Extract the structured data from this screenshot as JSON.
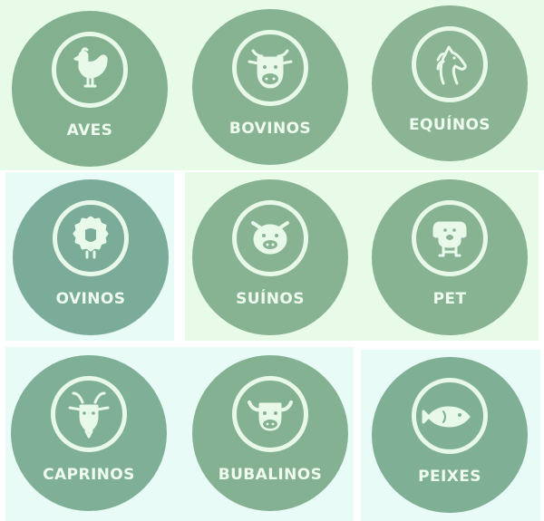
{
  "categories": [
    {
      "label": "AVES",
      "icon": "chicken-icon",
      "color": "#83b190"
    },
    {
      "label": "BOVINOS",
      "icon": "cow-icon",
      "color": "#87b392"
    },
    {
      "label": "EQUÍNOS",
      "icon": "horse-icon",
      "color": "#8ab493"
    },
    {
      "label": "OVINOS",
      "icon": "sheep-icon",
      "color": "#7bac99"
    },
    {
      "label": "SUÍNOS",
      "icon": "pig-icon",
      "color": "#87b392"
    },
    {
      "label": "PET",
      "icon": "dog-icon",
      "color": "#87b392"
    },
    {
      "label": "CAPRINOS",
      "icon": "goat-icon",
      "color": "#7fb097"
    },
    {
      "label": "BUBALINOS",
      "icon": "buffalo-icon",
      "color": "#83b191"
    },
    {
      "label": "PEIXES",
      "icon": "fish-icon",
      "color": "#7fb096"
    }
  ],
  "colors": {
    "panel_green": "#e8fbe9",
    "panel_mint": "#e9fbf6",
    "icon_stroke": "#e9f9e9"
  }
}
